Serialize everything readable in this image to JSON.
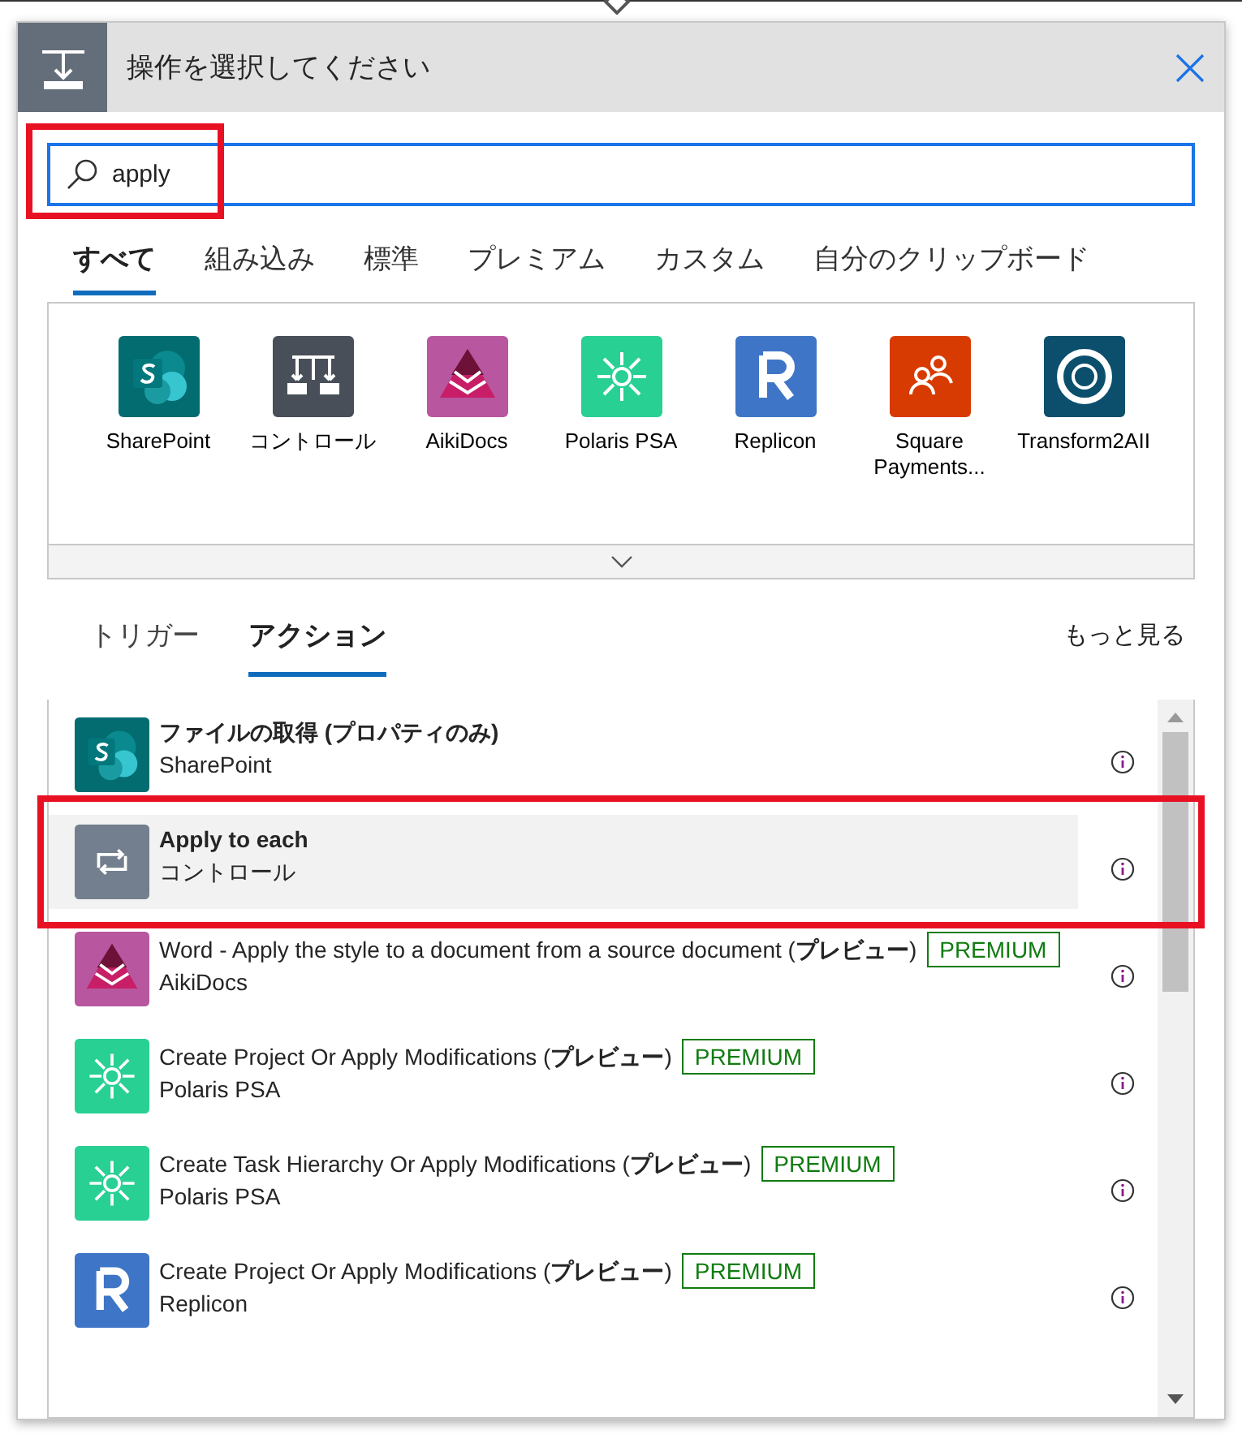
{
  "panel": {
    "title": "操作を選択してください"
  },
  "search": {
    "value": "apply",
    "highlighted": true
  },
  "category_tabs": [
    {
      "label": "すべて",
      "selected": true
    },
    {
      "label": "組み込み",
      "selected": false
    },
    {
      "label": "標準",
      "selected": false
    },
    {
      "label": "プレミアム",
      "selected": false
    },
    {
      "label": "カスタム",
      "selected": false
    },
    {
      "label": "自分のクリップボード",
      "selected": false
    }
  ],
  "connectors": [
    {
      "name": "SharePoint",
      "kind": "sharepoint",
      "color": "#036c70"
    },
    {
      "name": "コントロール",
      "kind": "control",
      "color": "#484f58"
    },
    {
      "name": "AikiDocs",
      "kind": "aikidocs",
      "color": "#b8569f"
    },
    {
      "name": "Polaris PSA",
      "kind": "polaris",
      "color": "#28d093"
    },
    {
      "name": "Replicon",
      "kind": "replicon",
      "color": "#3f75c6"
    },
    {
      "name": "Square Payments...",
      "kind": "square",
      "color": "#d83b01"
    },
    {
      "name": "Transform2AII",
      "kind": "transform",
      "color": "#0b4f6c"
    }
  ],
  "action_tabs": [
    {
      "label": "トリガー",
      "selected": false
    },
    {
      "label": "アクション",
      "selected": true
    }
  ],
  "more_link": "もっと見る",
  "actions": [
    {
      "title": "ファイルの取得 (プロパティのみ)",
      "bold": true,
      "connector": "SharePoint",
      "kind": "sharepoint",
      "color": "#036c70",
      "selected": false,
      "highlighted": false
    },
    {
      "title": "Apply to each",
      "bold": true,
      "connector": "コントロール",
      "kind": "loop",
      "color": "#737f8f",
      "selected": true,
      "highlighted": true
    },
    {
      "title": "Word - Apply the style to a document from a source document (**プレビュー**)",
      "bold": false,
      "badge": "PREMIUM",
      "connector": "AikiDocs",
      "kind": "aikidocs",
      "color": "#b8569f",
      "selected": false,
      "highlighted": false
    },
    {
      "title": "Create Project Or Apply Modifications (**プレビュー**)",
      "bold": false,
      "badge": "PREMIUM",
      "connector": "Polaris PSA",
      "kind": "polaris",
      "color": "#28d093",
      "selected": false,
      "highlighted": false
    },
    {
      "title": "Create Task Hierarchy Or Apply Modifications (**プレビュー**)",
      "bold": false,
      "badge": "PREMIUM",
      "connector": "Polaris PSA",
      "kind": "polaris",
      "color": "#28d093",
      "selected": false,
      "highlighted": false
    },
    {
      "title": "Create Project Or Apply Modifications (**プレビュー**)",
      "bold": false,
      "badge": "PREMIUM",
      "connector": "Replicon",
      "kind": "replicon",
      "color": "#3f75c6",
      "selected": false,
      "highlighted": false
    }
  ]
}
